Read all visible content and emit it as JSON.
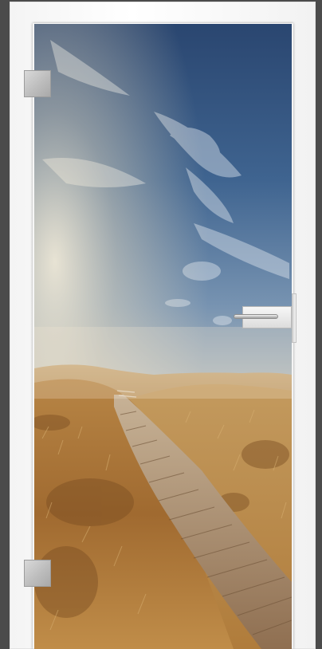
{
  "image": {
    "subject": "glass-door-with-photo-print",
    "colors": {
      "background": "#4b4b4b",
      "frame": "#ffffff",
      "sky_top": "#2c4a72",
      "sky_mid": "#6f8fb0",
      "horizon_glow": "#efe3c8",
      "grass": "#b9894a",
      "boardwalk": "#9c7d5f"
    }
  }
}
